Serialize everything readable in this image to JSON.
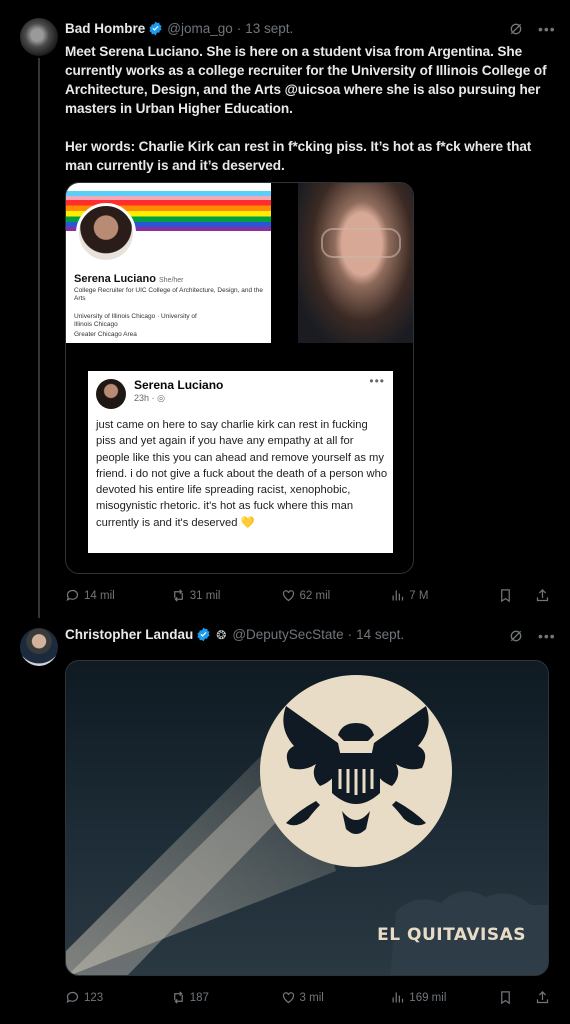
{
  "tweet1": {
    "name": "Bad Hombre",
    "handle": "@joma_go",
    "sep": "·",
    "date": "13 sept.",
    "text": "Meet Serena Luciano. She is here on a student visa from Argentina. She currently works as a college recruiter for the University of Illinois College of Architecture, Design, and the Arts @uicsoa where she is also pursuing her masters in Urban Higher Education.\n\nHer words: Charlie Kirk can rest in f*cking piss. It’s hot as f*ck where that man currently is and it’s deserved.",
    "actions": {
      "replies": "14 mil",
      "reposts": "31 mil",
      "likes": "62 mil",
      "views": "7 M"
    }
  },
  "linkedin": {
    "name": "Serena Luciano",
    "pronouns": "She/her",
    "headline": "College Recruiter for UIC College of Architecture, Design, and the Arts",
    "education": "University of Illinois Chicago · University of Illinois Chicago",
    "location": "Greater Chicago Area"
  },
  "facebook": {
    "name": "Serena Luciano",
    "time": "23h",
    "dot": "·",
    "text": "just came on here to say charlie kirk can rest in fucking piss and yet again if you have any empathy at all for people like this you can ahead and remove yourself as my friend. i do not give a fuck about the death of a person who devoted his entire life spreading racist, xenophobic, misogynistic rhetoric. it's hot as fuck where this man currently is and it's deserved",
    "emoji": "💛"
  },
  "tweet2": {
    "name": "Christopher Landau",
    "flag": "🇺🇸",
    "handle": "@DeputySecState",
    "sep": "·",
    "date": "14 sept.",
    "image_caption": "EL QUITAVISAS",
    "actions": {
      "replies": "123",
      "reposts": "187",
      "likes": "3 mil",
      "views": "169 mil"
    }
  },
  "colors": {
    "verified": "#1d9bf0",
    "muted": "#71767b",
    "moon": "#e8dcc6"
  }
}
